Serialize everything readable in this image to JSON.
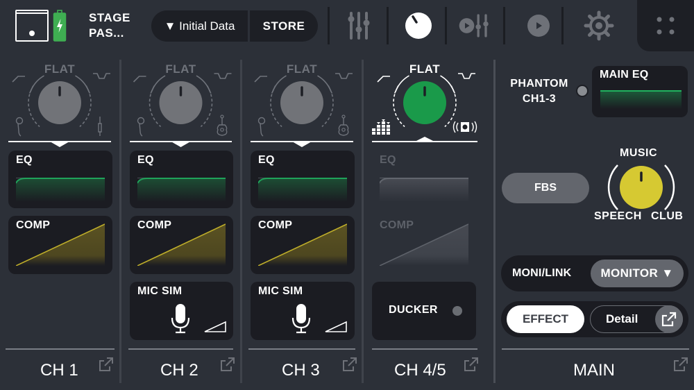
{
  "header": {
    "device_name_line1": "STAGE",
    "device_name_line2": "PAS...",
    "scene_recall_label": "▼ Initial Data",
    "store_label": "STORE",
    "toolbar_icons": [
      "mixer-faders-icon",
      "knob-icon",
      "player-mixer-icon",
      "play-icon",
      "settings-gear-icon"
    ],
    "active_toolbar_icon": "knob-icon",
    "battery_state": "charging",
    "menu_icon": "grid-dots-icon"
  },
  "channels": [
    {
      "id": "ch1",
      "label": "CH 1",
      "tone_label": "FLAT",
      "tone_active": false,
      "left_icon": "microphone-icon",
      "right_icon": "line-jack-icon",
      "eq_label": "EQ",
      "comp_label": "COMP",
      "eq_enabled": true,
      "comp_enabled": true
    },
    {
      "id": "ch2",
      "label": "CH 2",
      "tone_label": "FLAT",
      "tone_active": false,
      "left_icon": "microphone-icon",
      "right_icon": "acoustic-guitar-icon",
      "eq_label": "EQ",
      "comp_label": "COMP",
      "mic_sim_label": "MIC SIM",
      "eq_enabled": true,
      "comp_enabled": true
    },
    {
      "id": "ch3",
      "label": "CH 3",
      "tone_label": "FLAT",
      "tone_active": false,
      "left_icon": "microphone-icon",
      "right_icon": "acoustic-guitar-icon",
      "eq_label": "EQ",
      "comp_label": "COMP",
      "mic_sim_label": "MIC SIM",
      "eq_enabled": true,
      "comp_enabled": true
    },
    {
      "id": "ch45",
      "label": "CH 4/5",
      "tone_label": "FLAT",
      "tone_active": true,
      "left_icon": "level-meter-icon",
      "right_icon": "speaker-icon",
      "eq_label": "EQ",
      "comp_label": "COMP",
      "ducker_label": "DUCKER",
      "ducker_on": false,
      "eq_enabled": false,
      "comp_enabled": false
    }
  ],
  "main": {
    "label": "MAIN",
    "phantom_label_line1": "PHANTOM",
    "phantom_label_line2": "CH1-3",
    "phantom_on": false,
    "main_eq_label": "MAIN EQ",
    "fbs_label": "FBS",
    "preset_top": "MUSIC",
    "preset_left": "SPEECH",
    "preset_right": "CLUB",
    "preset_selected": "MUSIC",
    "moni_link_label": "MONI/LINK",
    "moni_link_value": "MONITOR ▼",
    "effect_label": "EFFECT",
    "detail_label": "Detail"
  },
  "colors": {
    "background": "#2c3038",
    "card": "#1b1c22",
    "eq_green": "#1fa35a",
    "comp_yellow": "#bfae2a",
    "knob_green": "#1a9a4a",
    "knob_yellow": "#d6c932",
    "knob_gray": "#717378"
  }
}
